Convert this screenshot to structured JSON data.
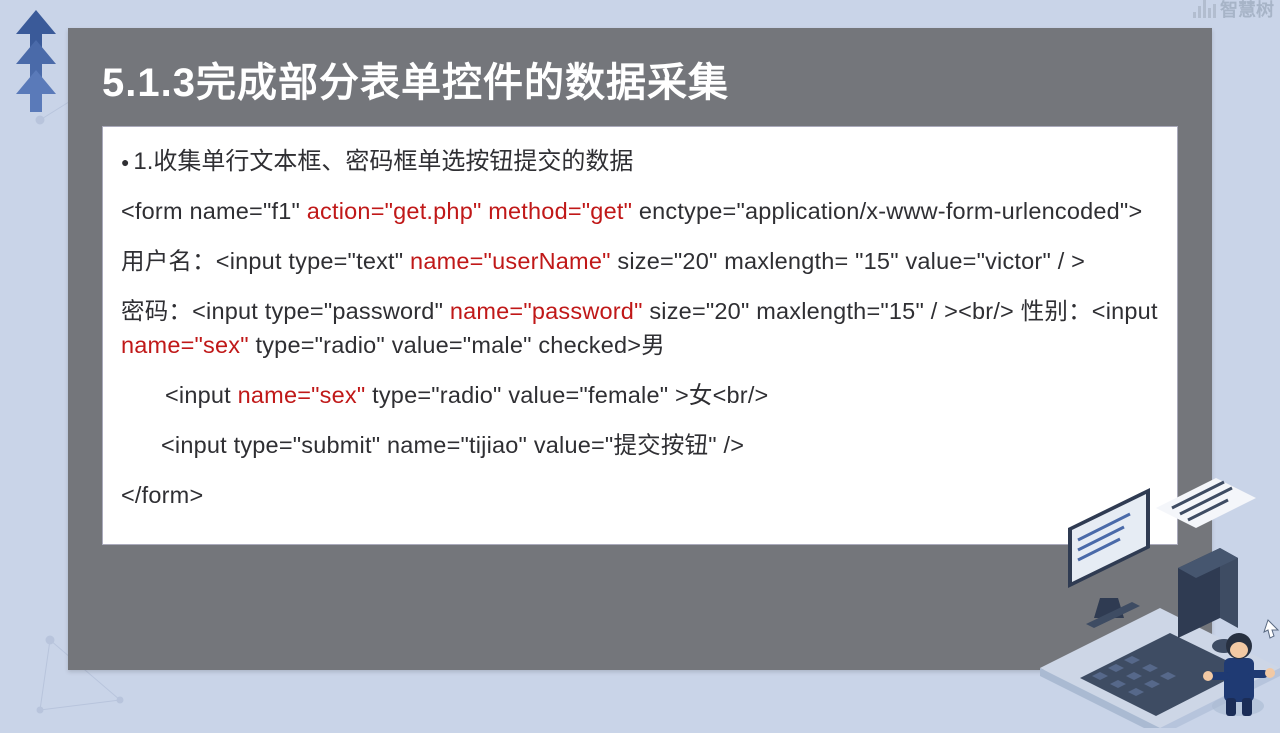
{
  "watermark": {
    "text": "智慧树"
  },
  "slide": {
    "title": "5.1.3完成部分表单控件的数据采集",
    "bullet": "1.收集单行文本框、密码框单选按钮提交的数据",
    "code": {
      "line1_a": "<form name=\"f1\" ",
      "line1_red1": "action=\"get.php\"",
      "line1_b": "   ",
      "line1_red2": "method=\"get\"",
      "line1_c": "   enctype=\"application/x-www-form-urlencoded\">",
      "line2_a": "用户名：<input type=\"text\" ",
      "line2_red": "name=\"userName\"",
      "line2_b": "  size=\"20\"  maxlength= \"15\"  value=\"victor\" / >",
      "line3_a": "密码：<input type=\"password\" ",
      "line3_red": "name=\"password\"",
      "line3_b": "  size=\"20\"  maxlength=\"15\"  / ><br/>   性别：<input ",
      "line3_red2": "name=\"sex\"",
      "line3_c": " type=\"radio\" value=\"male\" checked>男",
      "line4_a": "<input ",
      "line4_red": "name=\"sex\"",
      "line4_b": " type=\"radio\" value=\"female\" >女<br/>",
      "line5": "<input type=\"submit\" name=\"tijiao\" value=\"提交按钮\" />",
      "line6": "</form>"
    }
  }
}
